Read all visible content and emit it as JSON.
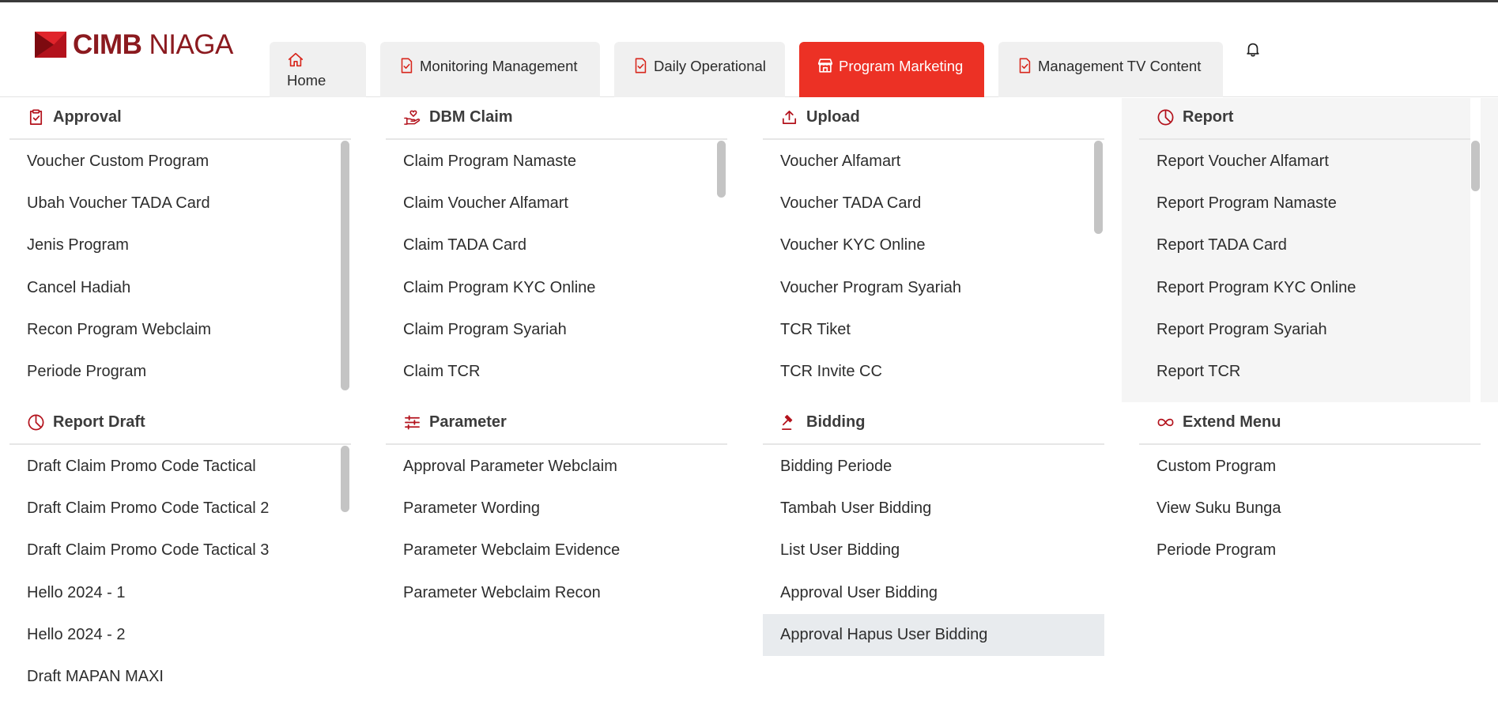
{
  "brand": {
    "name_bold": "CIMB",
    "name_light": "NIAGA"
  },
  "nav": {
    "tabs": [
      {
        "label": "Home",
        "icon": "home-icon",
        "active": false
      },
      {
        "label": "Monitoring Management",
        "icon": "checklist-icon",
        "active": false
      },
      {
        "label": "Daily Operational",
        "icon": "checklist-icon",
        "active": false
      },
      {
        "label": "Program Marketing",
        "icon": "store-icon",
        "active": true
      },
      {
        "label": "Management TV Content",
        "icon": "checklist-icon",
        "active": false
      }
    ],
    "notification_icon": "bell-icon"
  },
  "colors": {
    "accent": "#ec3125",
    "brand": "#8b1a1f",
    "icon": "#b3121c",
    "hover": "#e8ebee"
  },
  "sections": {
    "approval": {
      "title": "Approval",
      "icon": "clipboard-check-icon",
      "items": [
        "Voucher Custom Program",
        "Ubah Voucher TADA Card",
        "Jenis Program",
        "Cancel Hadiah",
        "Recon Program Webclaim",
        "Periode Program"
      ]
    },
    "dbm_claim": {
      "title": "DBM Claim",
      "icon": "hand-heart-icon",
      "items": [
        "Claim Program Namaste",
        "Claim Voucher Alfamart",
        "Claim TADA Card",
        "Claim Program KYC Online",
        "Claim Program Syariah",
        "Claim TCR"
      ]
    },
    "upload": {
      "title": "Upload",
      "icon": "upload-icon",
      "items": [
        "Voucher Alfamart",
        "Voucher TADA Card",
        "Voucher KYC Online",
        "Voucher Program Syariah",
        "TCR Tiket",
        "TCR Invite CC"
      ]
    },
    "report": {
      "title": "Report",
      "icon": "pie-chart-icon",
      "items": [
        "Report Voucher Alfamart",
        "Report Program Namaste",
        "Report TADA Card",
        "Report Program KYC Online",
        "Report Program Syariah",
        "Report TCR"
      ]
    },
    "report_draft": {
      "title": "Report Draft",
      "icon": "pie-chart-icon",
      "items": [
        "Draft Claim Promo Code Tactical",
        "Draft Claim Promo Code Tactical 2",
        "Draft Claim Promo Code Tactical 3",
        "Hello 2024 - 1",
        "Hello 2024 - 2",
        "Draft MAPAN MAXI"
      ]
    },
    "parameter": {
      "title": "Parameter",
      "icon": "sliders-icon",
      "items": [
        "Approval Parameter Webclaim",
        "Parameter Wording",
        "Parameter Webclaim Evidence",
        "Parameter Webclaim Recon"
      ]
    },
    "bidding": {
      "title": "Bidding",
      "icon": "gavel-icon",
      "items": [
        "Bidding Periode",
        "Tambah User Bidding",
        "List User Bidding",
        "Approval User Bidding",
        "Approval Hapus User Bidding"
      ]
    },
    "extend_menu": {
      "title": "Extend Menu",
      "icon": "infinity-icon",
      "items": [
        "Custom Program",
        "View Suku Bunga",
        "Periode Program"
      ]
    }
  }
}
